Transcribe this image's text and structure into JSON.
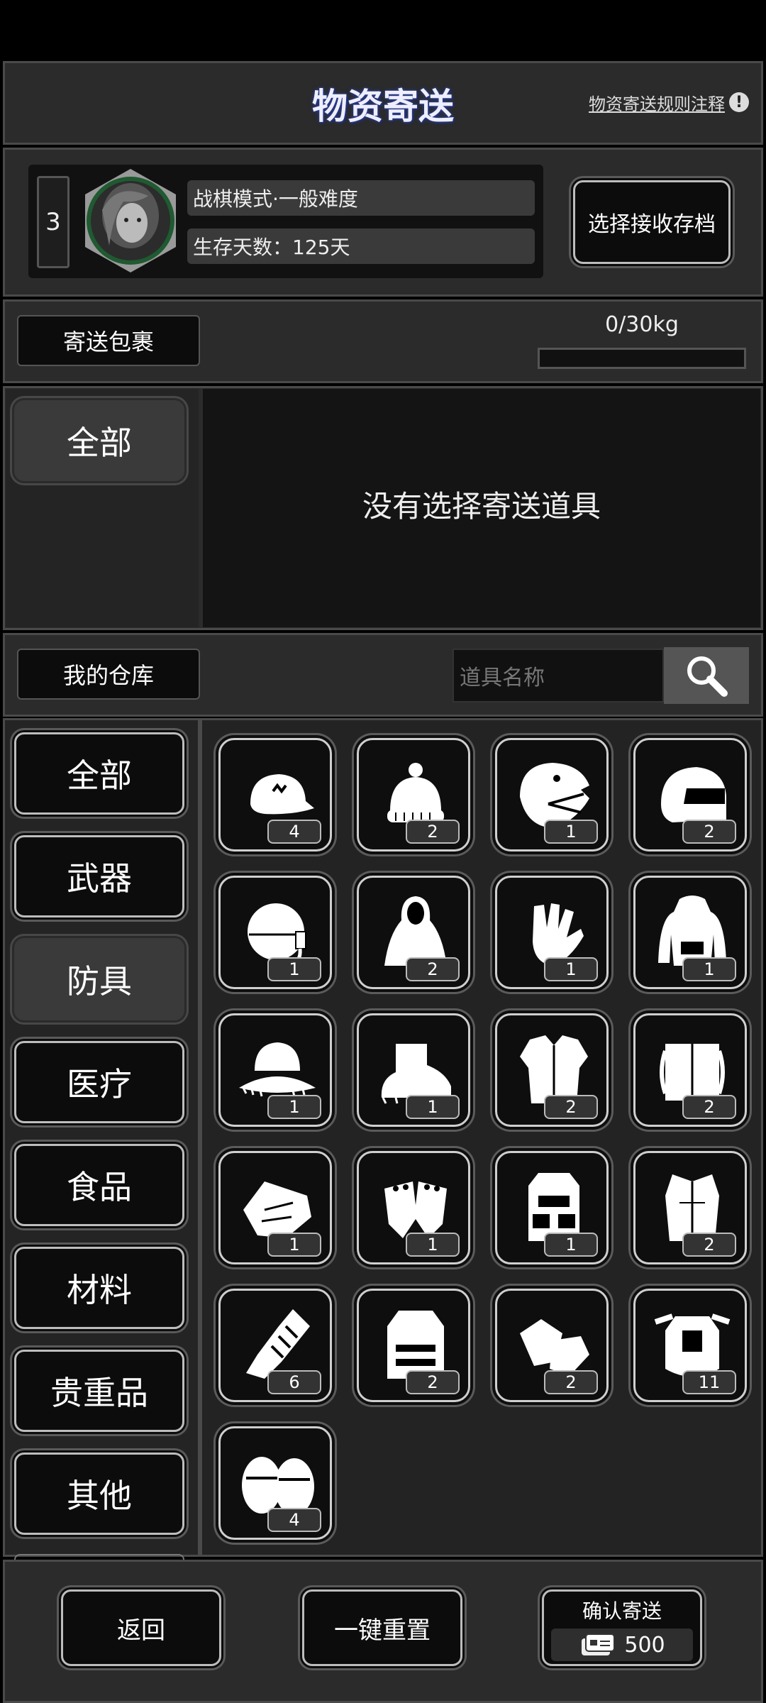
{
  "header": {
    "title": "物资寄送",
    "rules_link": "物资寄送规则注释"
  },
  "profile": {
    "level": "3",
    "mode": "战棋模式·一般难度",
    "survival_days": "生存天数：125天",
    "select_save": "选择接收存档"
  },
  "package": {
    "label": "寄送包裹",
    "weight": "0/30kg",
    "weight_fraction": 0,
    "category_all": "全部",
    "empty_message": "没有选择寄送道具"
  },
  "warehouse": {
    "label": "我的仓库",
    "search_placeholder": "道具名称",
    "categories": [
      "全部",
      "武器",
      "防具",
      "医疗",
      "食品",
      "材料",
      "贵重品",
      "其他"
    ],
    "active_category": "防具",
    "items": [
      {
        "icon": "baseball-cap-icon",
        "count": "4"
      },
      {
        "icon": "beanie-hat-icon",
        "count": "2"
      },
      {
        "icon": "dinosaur-mask-icon",
        "count": "1"
      },
      {
        "icon": "motorcycle-helmet-icon",
        "count": "2"
      },
      {
        "icon": "pilot-helmet-icon",
        "count": "1"
      },
      {
        "icon": "hooded-cloak-icon",
        "count": "2"
      },
      {
        "icon": "gloves-icon",
        "count": "1"
      },
      {
        "icon": "hoodie-icon",
        "count": "1"
      },
      {
        "icon": "fur-hat-icon",
        "count": "1"
      },
      {
        "icon": "fur-boots-icon",
        "count": "1"
      },
      {
        "icon": "fur-vest-icon",
        "count": "2"
      },
      {
        "icon": "fur-coat-icon",
        "count": "2"
      },
      {
        "icon": "leather-gloves-icon",
        "count": "1"
      },
      {
        "icon": "fingerless-gloves-icon",
        "count": "1"
      },
      {
        "icon": "tactical-vest-icon",
        "count": "1"
      },
      {
        "icon": "fur-jacket-icon",
        "count": "2"
      },
      {
        "icon": "armored-gauntlet-icon",
        "count": "6"
      },
      {
        "icon": "bulletproof-vest-icon",
        "count": "2"
      },
      {
        "icon": "work-gloves-icon",
        "count": "2"
      },
      {
        "icon": "body-armor-icon",
        "count": "11"
      },
      {
        "icon": "knee-pads-icon",
        "count": "4"
      }
    ]
  },
  "footer": {
    "back": "返回",
    "reset": "一键重置",
    "confirm": "确认寄送",
    "cost": "500"
  },
  "colors": {
    "background": "#000000",
    "panel": "#2b2b2b",
    "accent": "#bdbdbd"
  }
}
